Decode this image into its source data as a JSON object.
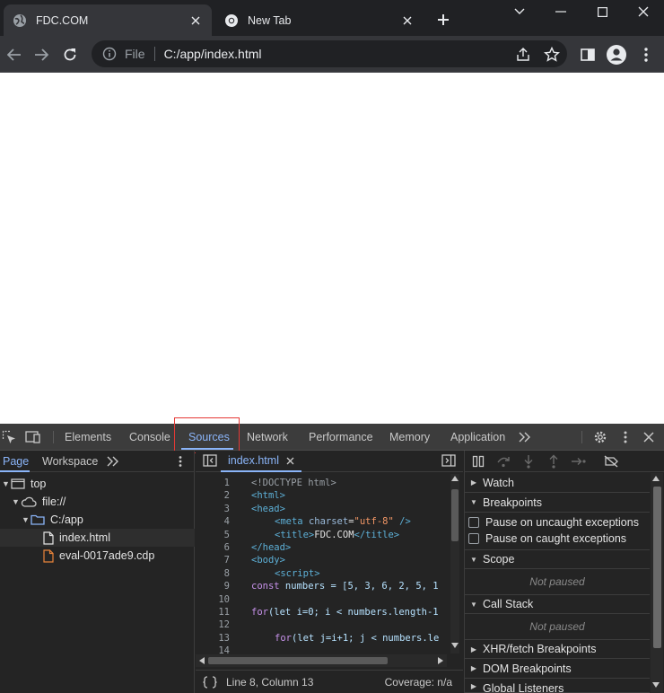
{
  "browser": {
    "tabs": [
      {
        "title": "FDC.COM",
        "icon": "globe-icon",
        "active": true
      },
      {
        "title": "New Tab",
        "icon": "chrome-icon",
        "active": false
      }
    ],
    "address": {
      "scheme_label": "File",
      "url": "C:/app/index.html"
    }
  },
  "devtools": {
    "tabs": [
      "Elements",
      "Console",
      "Sources",
      "Network",
      "Performance",
      "Memory",
      "Application"
    ],
    "selected_tab": "Sources",
    "navigator": {
      "tabs": [
        "Page",
        "Workspace"
      ],
      "tree": [
        {
          "label": "top",
          "icon": "frame-icon"
        },
        {
          "label": "file://",
          "icon": "cloud-icon"
        },
        {
          "label": "C:/app",
          "icon": "folder-icon"
        },
        {
          "label": "index.html",
          "icon": "file-icon"
        },
        {
          "label": "eval-0017ade9.cdp",
          "icon": "file-icon"
        }
      ]
    },
    "editor": {
      "open_file": "index.html",
      "line_numbers": [
        "1",
        "2",
        "3",
        "4",
        "5",
        "6",
        "7",
        "8",
        "9",
        "10",
        "11",
        "12",
        "13",
        "14"
      ],
      "code": {
        "l1": "<!DOCTYPE html>",
        "l2": "<html>",
        "l3": "<head>",
        "l4_tag_open": "<meta",
        "l4_attr": "charset",
        "l4_eq": "=",
        "l4_val": "\"utf-8\"",
        "l4_tag_close": " />",
        "l5_open": "<title>",
        "l5_text": "FDC.COM",
        "l5_close": "</title>",
        "l6": "</head>",
        "l7": "<body>",
        "l8": "<script>",
        "l9_kw": "const",
        "l9_rest": " numbers = [5, 3, 6, 2, 5, 1",
        "l11_kw": "for",
        "l11_rest": "(let i=0; i < numbers.length-1",
        "l13_kw": "for",
        "l13_rest": "(let j=i+1; j < numbers.le"
      },
      "status": {
        "position": "Line 8, Column 13",
        "coverage": "Coverage: n/a"
      }
    },
    "debugger": {
      "sections": {
        "watch": "Watch",
        "breakpoints": "Breakpoints",
        "scope": "Scope",
        "call_stack": "Call Stack",
        "xhr": "XHR/fetch Breakpoints",
        "dom": "DOM Breakpoints",
        "global": "Global Listeners"
      },
      "pause_uncaught": "Pause on uncaught exceptions",
      "pause_caught": "Pause on caught exceptions",
      "not_paused": "Not paused"
    }
  },
  "colors": {
    "accent": "#8ab4f8",
    "highlight_box": "#e53935",
    "file_orange": "#e8833a"
  }
}
